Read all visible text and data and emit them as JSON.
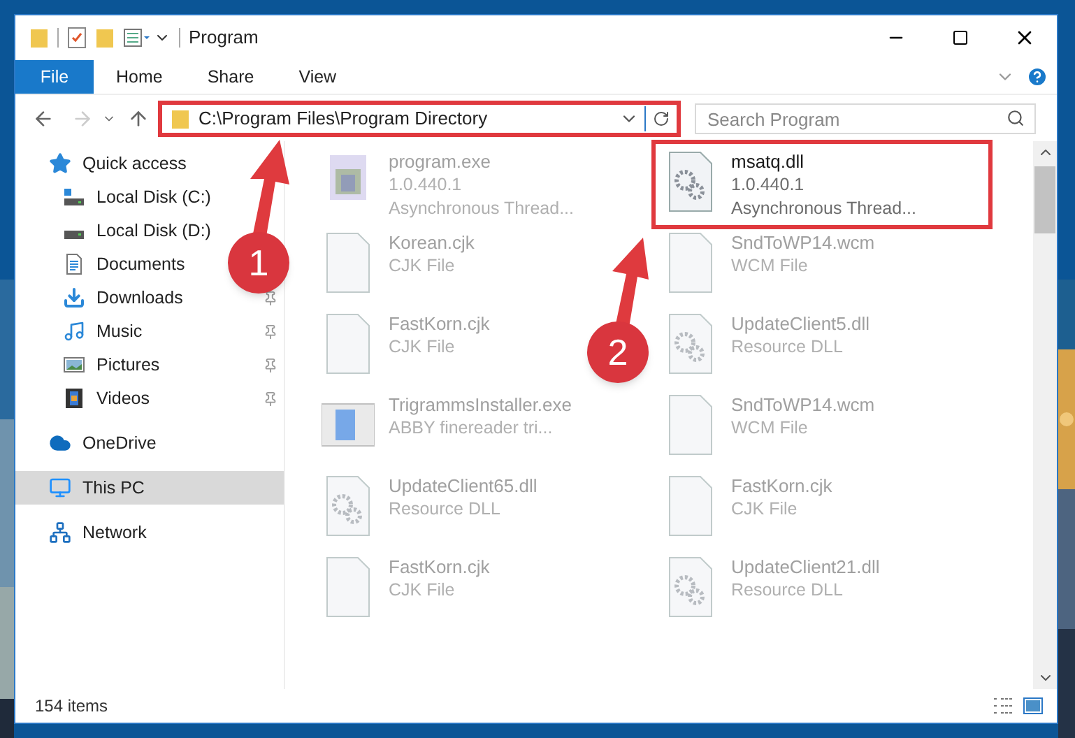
{
  "window": {
    "title": "Program"
  },
  "file_button": {
    "label": "File"
  },
  "ribbon_tabs": [
    {
      "label": "Home",
      "selected": false
    },
    {
      "label": "Share",
      "selected": false
    },
    {
      "label": "View",
      "selected": false
    }
  ],
  "address": {
    "path": "C:\\Program Files\\Program Directory",
    "highlighted": true
  },
  "search": {
    "placeholder": "Search Program"
  },
  "sidebar": {
    "items": [
      {
        "label": "Quick access",
        "kind": "star",
        "selected": false,
        "children": [
          {
            "label": "Local Disk (C:)",
            "kind": "system-drive",
            "pinned": false,
            "selected": false
          },
          {
            "label": "Local Disk (D:)",
            "kind": "drive",
            "pinned": false,
            "selected": false
          },
          {
            "label": "Documents",
            "kind": "document",
            "pinned": false,
            "selected": false
          },
          {
            "label": "Downloads",
            "kind": "download",
            "pinned": true,
            "selected": false
          },
          {
            "label": "Music",
            "kind": "music",
            "pinned": true,
            "selected": false
          },
          {
            "label": "Pictures",
            "kind": "pictures",
            "pinned": true,
            "selected": false
          },
          {
            "label": "Videos",
            "kind": "videos",
            "pinned": true,
            "selected": false
          }
        ]
      },
      {
        "label": "OneDrive",
        "kind": "cloud",
        "selected": false
      },
      {
        "label": "This PC",
        "kind": "pc",
        "selected": true
      },
      {
        "label": "Network",
        "kind": "network",
        "selected": false
      }
    ]
  },
  "files": [
    {
      "name": "program.exe",
      "details": [
        "1.0.440.1",
        "Asynchronous Thread..."
      ],
      "kind": "exe",
      "dimmed": true,
      "highlighted": false
    },
    {
      "name": "msatq.dll",
      "details": [
        "1.0.440.1",
        "Asynchronous Thread..."
      ],
      "kind": "dll",
      "dimmed": false,
      "highlighted": true
    },
    {
      "name": "Korean.cjk",
      "details": [
        "CJK File"
      ],
      "kind": "blank",
      "dimmed": true,
      "highlighted": false
    },
    {
      "name": "SndToWP14.wcm",
      "details": [
        "WCM File"
      ],
      "kind": "blank",
      "dimmed": true,
      "highlighted": false
    },
    {
      "name": "FastKorn.cjk",
      "details": [
        "CJK File"
      ],
      "kind": "blank",
      "dimmed": true,
      "highlighted": false
    },
    {
      "name": "UpdateClient5.dll",
      "details": [
        "Resource DLL"
      ],
      "kind": "dll",
      "dimmed": true,
      "highlighted": false
    },
    {
      "name": "TrigrammsInstaller.exe",
      "details": [
        "ABBY finereader tri..."
      ],
      "kind": "installer",
      "dimmed": true,
      "highlighted": false
    },
    {
      "name": "SndToWP14.wcm",
      "details": [
        "WCM File"
      ],
      "kind": "blank",
      "dimmed": true,
      "highlighted": false
    },
    {
      "name": "UpdateClient65.dll",
      "details": [
        "Resource DLL"
      ],
      "kind": "dll",
      "dimmed": true,
      "highlighted": false
    },
    {
      "name": "FastKorn.cjk",
      "details": [
        "CJK File"
      ],
      "kind": "blank",
      "dimmed": true,
      "highlighted": false
    },
    {
      "name": "FastKorn.cjk",
      "details": [
        "CJK File"
      ],
      "kind": "blank",
      "dimmed": true,
      "highlighted": false
    },
    {
      "name": "UpdateClient21.dll",
      "details": [
        "Resource DLL"
      ],
      "kind": "dll",
      "dimmed": true,
      "highlighted": false
    }
  ],
  "status_bar": {
    "count": "154 items"
  },
  "annotations": [
    {
      "number": "1"
    },
    {
      "number": "2"
    }
  ]
}
